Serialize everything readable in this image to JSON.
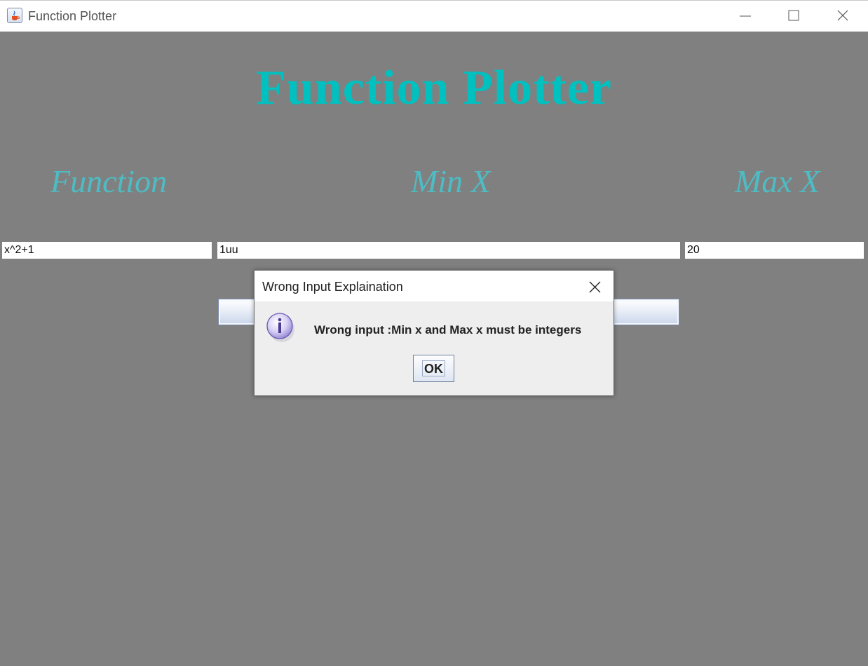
{
  "window": {
    "title": "Function Plotter",
    "icon": "java-cup-icon"
  },
  "main": {
    "heading": "Function Plotter",
    "labels": {
      "function": "Function",
      "min_x": "Min X",
      "max_x": "Max X"
    },
    "inputs": {
      "function_value": "x^2+1",
      "min_x_value": "1uu",
      "max_x_value": "20"
    }
  },
  "dialog": {
    "title": "Wrong Input Explaination",
    "message": "Wrong input :Min x and Max x must be integers",
    "ok_label": "OK",
    "icon": "info-icon"
  },
  "colors": {
    "background": "#808080",
    "heading": "#00c0c0",
    "labels": "#4dbcc4"
  }
}
